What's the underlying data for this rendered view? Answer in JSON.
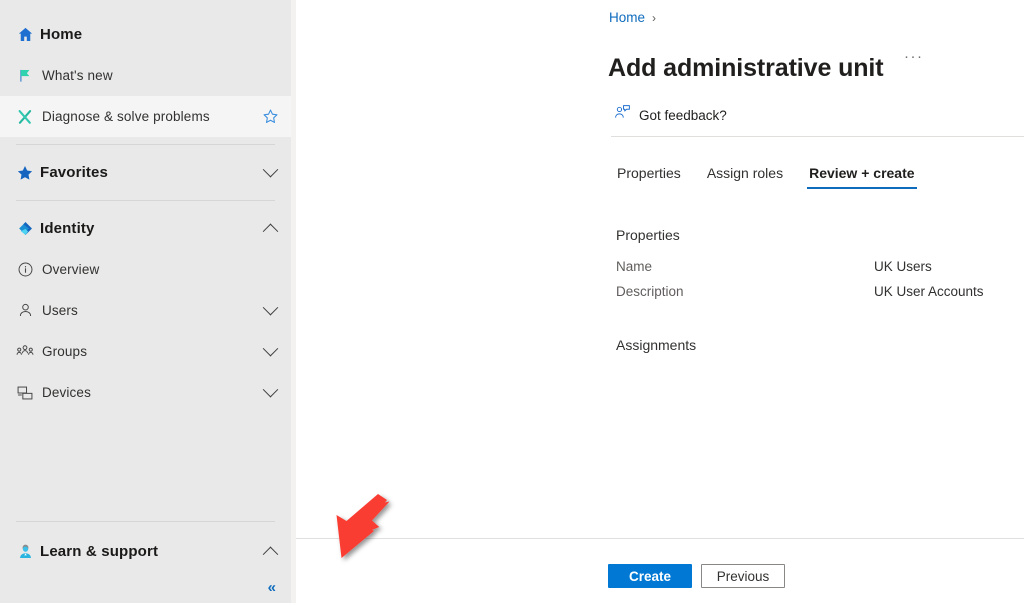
{
  "sidebar": {
    "items": [
      {
        "label": "Home",
        "icon": "home-icon",
        "style": "bold",
        "expand": "none",
        "selected": false
      },
      {
        "label": "What's new",
        "icon": "flag-icon",
        "style": "sub",
        "expand": "none",
        "selected": false
      },
      {
        "label": "Diagnose & solve problems",
        "icon": "wrench-screwdriver-icon",
        "style": "sub",
        "expand": "none",
        "selected": true,
        "favorite": true
      }
    ],
    "favorites": {
      "label": "Favorites",
      "icon": "star-icon",
      "expand": "down"
    },
    "identity": {
      "label": "Identity",
      "icon": "entra-diamond-icon",
      "expand": "up"
    },
    "identity_children": [
      {
        "label": "Overview",
        "icon": "info-circle-icon",
        "expand": "none"
      },
      {
        "label": "Users",
        "icon": "person-icon",
        "expand": "down"
      },
      {
        "label": "Groups",
        "icon": "group-icon",
        "expand": "down"
      },
      {
        "label": "Devices",
        "icon": "devices-icon",
        "expand": "down"
      }
    ],
    "learn_support": {
      "label": "Learn & support",
      "icon": "support-agent-icon",
      "expand": "up"
    },
    "collapse_label": "«"
  },
  "content": {
    "breadcrumb": {
      "home": "Home",
      "separator": "›"
    },
    "title": "Add administrative unit",
    "title_more": "···",
    "command_bar": {
      "feedback_label": "Got feedback?",
      "feedback_icon": "feedback-person-icon"
    },
    "tabs": [
      {
        "label": "Properties",
        "active": false
      },
      {
        "label": "Assign roles",
        "active": false
      },
      {
        "label": "Review + create",
        "active": true
      }
    ],
    "sections": {
      "properties_heading": "Properties",
      "assignments_heading": "Assignments"
    },
    "properties": [
      {
        "label": "Name",
        "value": "UK Users"
      },
      {
        "label": "Description",
        "value": "UK User Accounts"
      }
    ],
    "footer": {
      "create_label": "Create",
      "previous_label": "Previous"
    }
  },
  "annotation": {
    "arrow_color": "#fa3c32",
    "arrow_name": "red-pointer-arrow"
  },
  "colors": {
    "accent": "#0078d4",
    "link": "#0f6cbd",
    "sidebar_bg": "#e9e9e9",
    "panel_bg": "#ffffff"
  }
}
